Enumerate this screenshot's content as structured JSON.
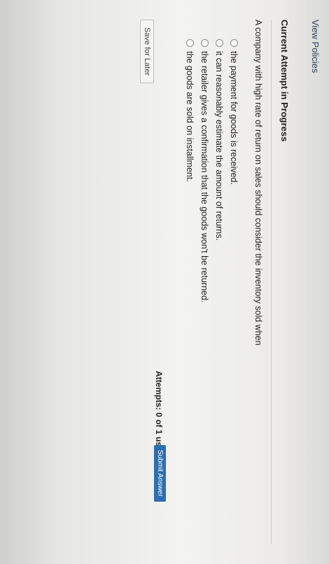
{
  "nav": {
    "view_policies": "View Policies"
  },
  "attempt": {
    "heading": "Current Attempt in Progress"
  },
  "question": {
    "text": "A company with high rate of return on sales should consider the inventory sold when",
    "options": [
      "the payment for goods is received.",
      "it can reasonably estimate the amount of returns.",
      "the retailer gives a confirmation that the goods won't be returned.",
      "the goods are sold on installment."
    ]
  },
  "actions": {
    "save_label": "Save for Later",
    "attempts_text": "Attempts: 0 of 1 used",
    "submit_label": "Submit Answer"
  },
  "colors": {
    "submit_bg": "#2e6fae"
  }
}
